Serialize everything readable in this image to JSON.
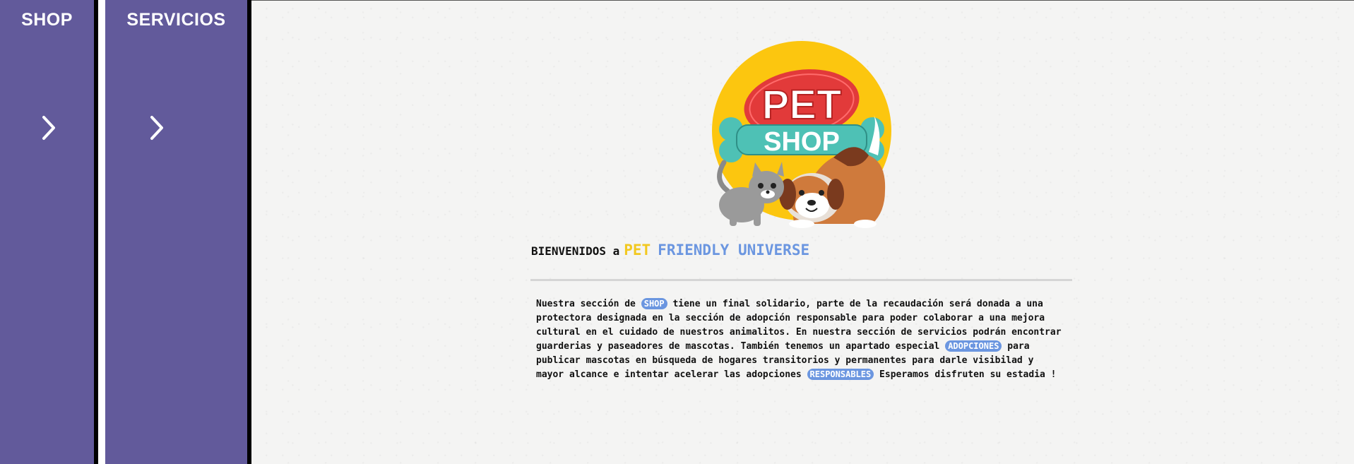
{
  "sidebar": {
    "shop": {
      "title": "SHOP",
      "arrow_icon": "chevron-right-icon"
    },
    "servicios": {
      "title": "SERVICIOS",
      "arrow_icon": "chevron-right-icon"
    }
  },
  "logo": {
    "top_text": "PET",
    "bottom_text": "SHOP",
    "icon": "pet-shop-logo"
  },
  "welcome": {
    "prefix": "BIENVENIDOS a",
    "highlight1": "PET",
    "highlight2": "FRIENDLY UNIVERSE"
  },
  "intro": {
    "t1": "Nuestra sección de",
    "pill1": "SHOP",
    "t2": "tiene un final solidario, parte de la recaudación será donada a una protectora designada en la sección de adopción responsable para poder colaborar a una mejora cultural en el cuidado de nuestros animalitos. En nuestra sección de servicios podrán encontrar guarderias y paseadores de mascotas. También tenemos un apartado especial",
    "pill2": "ADOPCIONES",
    "t3": "para publicar mascotas en búsqueda de hogares transitorios y permanentes para darle visibilad y mayor alcance e intentar acelerar las adopciones",
    "pill3": "RESPONSABLES",
    "t4": "Esperamos disfruten su estadia !"
  },
  "colors": {
    "panel": "#625a9b",
    "accent_yellow": "#f2c820",
    "accent_blue": "#6b96e0",
    "logo_circle": "#fcc60f",
    "logo_red": "#e23a3a",
    "logo_teal": "#4ec1b5"
  }
}
